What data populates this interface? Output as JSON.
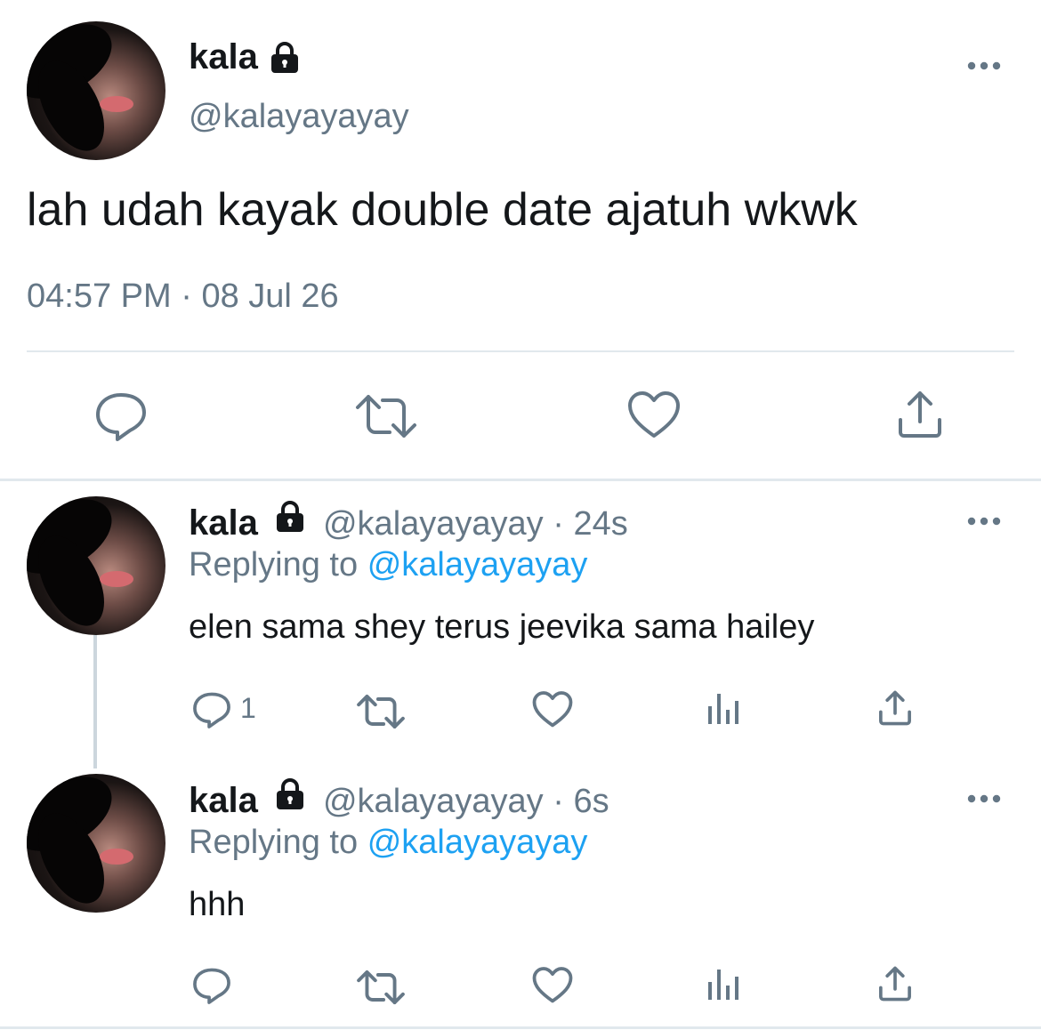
{
  "main_tweet": {
    "display_name": "kala",
    "handle": "@kalayayayay",
    "text": "lah udah kayak double date ajatuh wkwk",
    "time": "04:57 PM",
    "separator": "·",
    "date": "08 Jul 26",
    "actions": [
      "reply-icon",
      "retweet-icon",
      "like-icon",
      "share-icon"
    ]
  },
  "replies": [
    {
      "display_name": "kala",
      "handle": "@kalayayayay",
      "separator": "·",
      "time": "24s",
      "replying_prefix": "Replying to",
      "replying_to": "@kalayayayay",
      "text": "elen sama shey terus jeevika sama hailey",
      "reply_count": "1",
      "actions": [
        "reply-icon",
        "retweet-icon",
        "like-icon",
        "analytics-icon",
        "share-icon"
      ]
    },
    {
      "display_name": "kala",
      "handle": "@kalayayayay",
      "separator": "·",
      "time": "6s",
      "replying_prefix": "Replying to",
      "replying_to": "@kalayayayay",
      "text": "hhh",
      "reply_count": "",
      "actions": [
        "reply-icon",
        "retweet-icon",
        "like-icon",
        "analytics-icon",
        "share-icon"
      ]
    }
  ],
  "colors": {
    "text": "#14171a",
    "muted": "#657786",
    "link": "#1da1f2",
    "divider": "#e1e8ed"
  }
}
